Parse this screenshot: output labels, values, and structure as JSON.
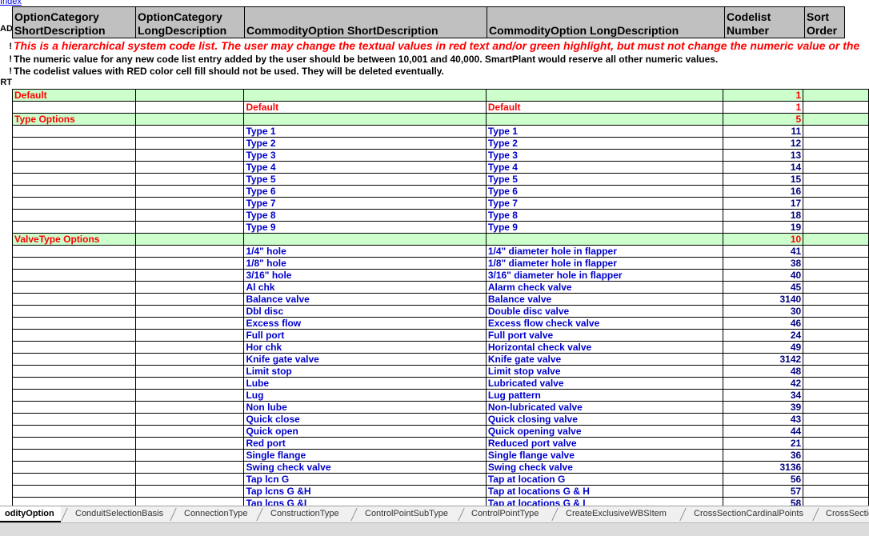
{
  "index_link": "Index",
  "gutter": {
    "head": "AD",
    "bang": "!",
    "start": "RT"
  },
  "headers": [
    [
      "OptionCategory",
      "ShortDescription"
    ],
    [
      "OptionCategory",
      "LongDescription"
    ],
    [
      "",
      "CommodityOption ShortDescription"
    ],
    [
      "",
      "CommodityOption LongDescription"
    ],
    [
      "Codelist",
      "Number"
    ],
    [
      "Sort",
      "Order"
    ]
  ],
  "notices": [
    "This is a hierarchical system code list. The user may change the textual values in red text and/or green highlight, but must not change the numeric value or the",
    "The numeric value for any new code list entry added by the user should be between 10,001 and 40,000. SmartPlant would reserve all other numeric values.",
    "The codelist values with RED color cell fill should not be used. They will be deleted eventually."
  ],
  "rows": [
    {
      "kind": "cat",
      "cat": "Default",
      "short": "",
      "long": "",
      "num": "1"
    },
    {
      "kind": "def",
      "cat": "",
      "short": "Default",
      "long": "Default",
      "num": "1"
    },
    {
      "kind": "cat",
      "cat": "Type Options",
      "short": "",
      "long": "",
      "num": "5"
    },
    {
      "kind": "opt",
      "cat": "",
      "short": "Type 1",
      "long": "Type 1",
      "num": "11"
    },
    {
      "kind": "opt",
      "cat": "",
      "short": "Type 2",
      "long": "Type 2",
      "num": "12"
    },
    {
      "kind": "opt",
      "cat": "",
      "short": "Type 3",
      "long": "Type 3",
      "num": "13"
    },
    {
      "kind": "opt",
      "cat": "",
      "short": "Type 4",
      "long": "Type 4",
      "num": "14"
    },
    {
      "kind": "opt",
      "cat": "",
      "short": "Type 5",
      "long": "Type 5",
      "num": "15"
    },
    {
      "kind": "opt",
      "cat": "",
      "short": "Type 6",
      "long": "Type 6",
      "num": "16"
    },
    {
      "kind": "opt",
      "cat": "",
      "short": "Type 7",
      "long": "Type 7",
      "num": "17"
    },
    {
      "kind": "opt",
      "cat": "",
      "short": "Type 8",
      "long": "Type 8",
      "num": "18"
    },
    {
      "kind": "opt",
      "cat": "",
      "short": "Type 9",
      "long": "Type 9",
      "num": "19"
    },
    {
      "kind": "cat",
      "cat": "ValveType Options",
      "short": "",
      "long": "",
      "num": "10"
    },
    {
      "kind": "opt",
      "cat": "",
      "short": "1/4\" hole",
      "long": "1/4\" diameter hole in flapper",
      "num": "41"
    },
    {
      "kind": "opt",
      "cat": "",
      "short": "1/8\" hole",
      "long": "1/8\" diameter hole in flapper",
      "num": "38"
    },
    {
      "kind": "opt",
      "cat": "",
      "short": "3/16\" hole",
      "long": "3/16\" diameter hole in flapper",
      "num": "40"
    },
    {
      "kind": "opt",
      "cat": "",
      "short": "Al chk",
      "long": "Alarm check valve",
      "num": "45"
    },
    {
      "kind": "opt",
      "cat": "",
      "short": "Balance valve",
      "long": "Balance valve",
      "num": "3140"
    },
    {
      "kind": "opt",
      "cat": "",
      "short": "Dbl disc",
      "long": "Double disc valve",
      "num": "30"
    },
    {
      "kind": "opt",
      "cat": "",
      "short": "Excess flow",
      "long": "Excess flow check valve",
      "num": "46"
    },
    {
      "kind": "opt",
      "cat": "",
      "short": "Full port",
      "long": "Full port valve",
      "num": "24"
    },
    {
      "kind": "opt",
      "cat": "",
      "short": "Hor chk",
      "long": "Horizontal check valve",
      "num": "49"
    },
    {
      "kind": "opt",
      "cat": "",
      "short": "Knife gate valve",
      "long": "Knife gate valve",
      "num": "3142"
    },
    {
      "kind": "opt",
      "cat": "",
      "short": "Limit stop",
      "long": "Limit stop valve",
      "num": "48"
    },
    {
      "kind": "opt",
      "cat": "",
      "short": "Lube",
      "long": "Lubricated valve",
      "num": "42"
    },
    {
      "kind": "opt",
      "cat": "",
      "short": "Lug",
      "long": "Lug pattern",
      "num": "34"
    },
    {
      "kind": "opt",
      "cat": "",
      "short": "Non lube",
      "long": "Non-lubricated valve",
      "num": "39"
    },
    {
      "kind": "opt",
      "cat": "",
      "short": "Quick close",
      "long": "Quick closing valve",
      "num": "43"
    },
    {
      "kind": "opt",
      "cat": "",
      "short": "Quick open",
      "long": "Quick opening valve",
      "num": "44"
    },
    {
      "kind": "opt",
      "cat": "",
      "short": "Red port",
      "long": "Reduced port valve",
      "num": "21"
    },
    {
      "kind": "opt",
      "cat": "",
      "short": "Single flange",
      "long": "Single flange valve",
      "num": "36"
    },
    {
      "kind": "opt",
      "cat": "",
      "short": "Swing check valve",
      "long": "Swing check valve",
      "num": "3136"
    },
    {
      "kind": "opt",
      "cat": "",
      "short": "Tap lcn G",
      "long": "Tap at location G",
      "num": "56"
    },
    {
      "kind": "opt",
      "cat": "",
      "short": "Tap lcns G &H",
      "long": "Tap at locations G & H",
      "num": "57"
    },
    {
      "kind": "opt",
      "cat": "",
      "short": "Tap lcns G &I",
      "long": "Tap at locations G & I",
      "num": "58"
    }
  ],
  "tabs": [
    "odityOption",
    "ConduitSelectionBasis",
    "ConnectionType",
    "ConstructionType",
    "ControlPointSubType",
    "ControlPointType",
    "CreateExclusiveWBSItem",
    "CrossSectionCardinalPoints",
    "CrossSectio"
  ],
  "colors": {
    "header_fill": "#c0c0c0",
    "category_fill": "#ccffcc",
    "category_text": "#ff0000",
    "option_text": "#0000cc",
    "notice_text": "#ff0000",
    "link": "#0000ee"
  }
}
